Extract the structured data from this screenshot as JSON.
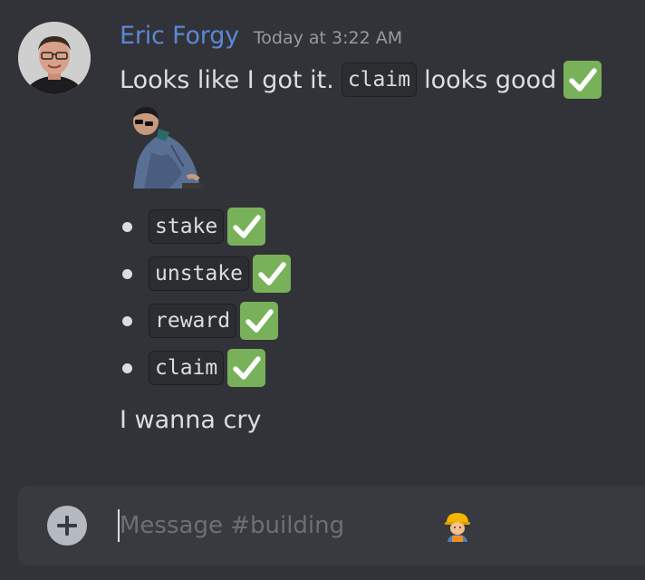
{
  "message": {
    "author": "Eric Forgy",
    "timestamp": "Today at 3:22 AM",
    "line1": {
      "text_before": "Looks like I got it.",
      "code": "claim",
      "text_after": "looks good"
    },
    "list": [
      {
        "code": "stake",
        "status_icon": "check-mark-button"
      },
      {
        "code": "unstake",
        "status_icon": "check-mark-button"
      },
      {
        "code": "reward",
        "status_icon": "check-mark-button"
      },
      {
        "code": "claim",
        "status_icon": "check-mark-button"
      }
    ],
    "last_line": "I wanna cry",
    "sticker": "person-leaning-sticker"
  },
  "composer": {
    "placeholder": "Message #building",
    "placeholder_emoji": "construction-worker-emoji",
    "add_icon": "plus-circle-icon"
  },
  "colors": {
    "background": "#313338",
    "author_name": "#5c87d6",
    "check_badge": "#78b159",
    "composer_bg": "#383a40"
  }
}
